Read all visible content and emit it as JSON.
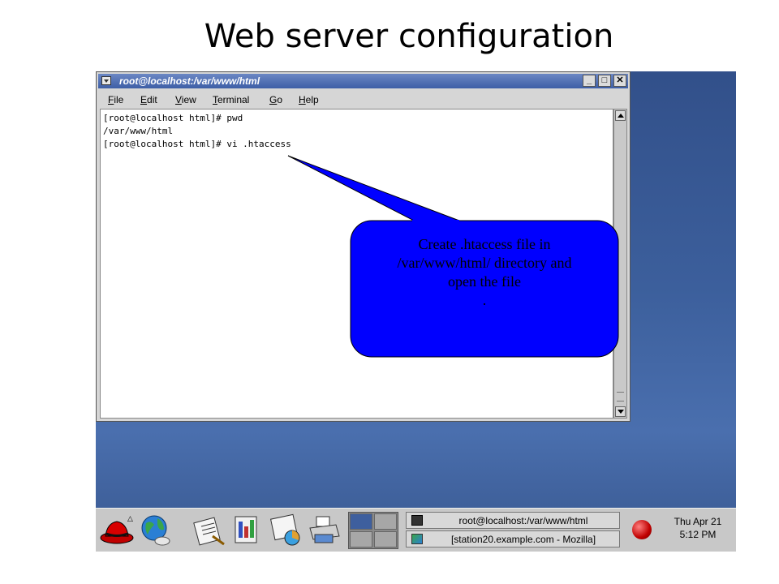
{
  "slide": {
    "title": "Web server configuration"
  },
  "window": {
    "title": "root@localhost:/var/www/html",
    "buttons": {
      "minimize": "_",
      "maximize": "□",
      "close": "✕"
    }
  },
  "menu": [
    "File",
    "Edit",
    "View",
    "Terminal",
    "Go",
    "Help"
  ],
  "terminal": {
    "lines": [
      "[root@localhost html]# pwd",
      "/var/www/html",
      "[root@localhost html]# vi .htaccess"
    ]
  },
  "callout": {
    "lines": [
      "Create .htaccess file in",
      "/var/www/html/ directory and",
      "open the file",
      "."
    ],
    "fill": "#0000ff",
    "border": "#000000"
  },
  "panel": {
    "tasks": [
      {
        "label": "root@localhost:/var/www/html",
        "icon": "terminal-icon"
      },
      {
        "label": "[station20.example.com - Mozilla]",
        "icon": "mozilla-icon"
      }
    ],
    "clock": {
      "day": "Thu Apr 21",
      "time": "5:12 PM"
    },
    "launchers": [
      "redhat-menu-icon",
      "web-browser-icon",
      "email-icon",
      "writer-icon",
      "impress-icon",
      "calc-icon",
      "print-manager-icon"
    ]
  },
  "colors": {
    "desktop": "#3c5f9c",
    "accent_titlebar": "#4a6bb0"
  }
}
